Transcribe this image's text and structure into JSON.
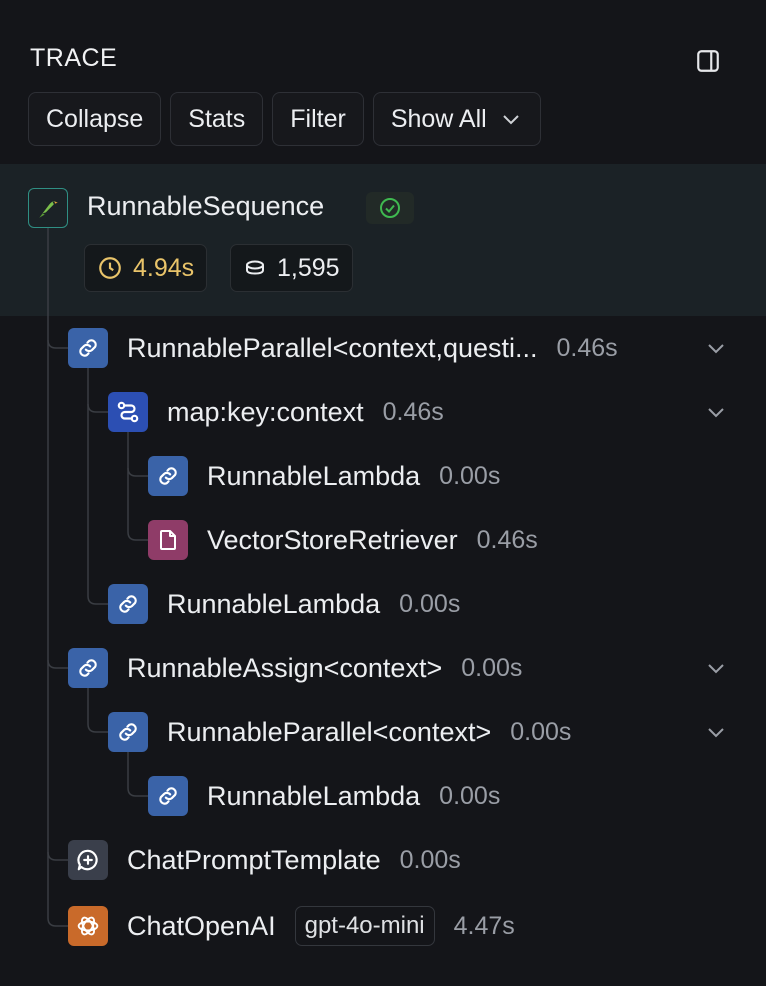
{
  "header": {
    "title": "TRACE",
    "panel_icon": "sidebar-toggle-icon"
  },
  "toolbar": {
    "collapse_label": "Collapse",
    "stats_label": "Stats",
    "filter_label": "Filter",
    "show_all_label": "Show All"
  },
  "root": {
    "name": "RunnableSequence",
    "status": "success",
    "latency": "4.94s",
    "tokens": "1,595"
  },
  "nodes": [
    {
      "name": "RunnableParallel<context,questi...",
      "duration": "0.46s",
      "icon": "link-icon"
    },
    {
      "name": "map:key:context",
      "duration": "0.46s",
      "icon": "route-icon"
    },
    {
      "name": "RunnableLambda",
      "duration": "0.00s",
      "icon": "link-icon"
    },
    {
      "name": "VectorStoreRetriever",
      "duration": "0.46s",
      "icon": "document-icon"
    },
    {
      "name": "RunnableLambda",
      "duration": "0.00s",
      "icon": "link-icon"
    },
    {
      "name": "RunnableAssign<context>",
      "duration": "0.00s",
      "icon": "link-icon"
    },
    {
      "name": "RunnableParallel<context>",
      "duration": "0.00s",
      "icon": "link-icon"
    },
    {
      "name": "RunnableLambda",
      "duration": "0.00s",
      "icon": "link-icon"
    },
    {
      "name": "ChatPromptTemplate",
      "duration": "0.00s",
      "icon": "chat-plus-icon"
    },
    {
      "name": "ChatOpenAI",
      "duration": "4.47s",
      "model": "gpt-4o-mini",
      "icon": "openai-icon"
    }
  ],
  "colors": {
    "background": "#141519",
    "root_highlight": "#1b2226",
    "link_icon": "#3a63a8",
    "document_icon": "#8f3c68",
    "openai_icon": "#c96a2a",
    "latency_text": "#e9c46a",
    "success": "#3fb950"
  }
}
